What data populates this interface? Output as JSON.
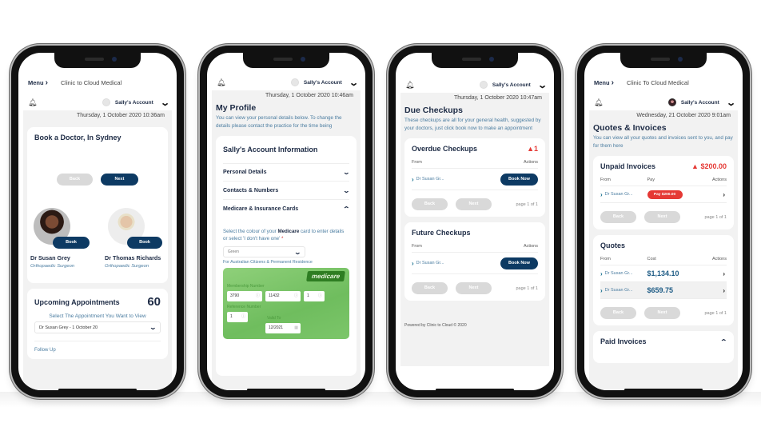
{
  "common": {
    "menu_label": "Menu",
    "account_name": "Sally's Account"
  },
  "phone1": {
    "clinic_name": "Clinic to Cloud Medical",
    "datetime": "Thursday, 1 October 2020 10:36am",
    "book_title": "Book a Doctor, In Sydney",
    "back_label": "Back",
    "next_label": "Next",
    "doctors": [
      {
        "name": "Dr Susan Grey",
        "specialty": "Orthopaedic Surgeon",
        "book_label": "Book"
      },
      {
        "name": "Dr Thomas Richards",
        "specialty": "Orthopaedic Surgeon",
        "book_label": "Book"
      }
    ],
    "appointments_title": "Upcoming Appointments",
    "appointments_count": "60",
    "appointments_subtitle": "Select The Appointment You Want to View",
    "appointment_selected": "Dr Susan Grey - 1 October 20",
    "follow_up": "Follow Up"
  },
  "phone2": {
    "datetime": "Thursday, 1 October 2020 10:46am",
    "page_title": "My Profile",
    "page_desc": "You can view your personal details below. To change the details please contact the practice for the time being",
    "card_title": "Sally's Account Information",
    "sections": [
      {
        "label": "Personal Details",
        "expanded": false
      },
      {
        "label": "Contacts & Numbers",
        "expanded": false
      },
      {
        "label": "Medicare & Insurance Cards",
        "expanded": true
      }
    ],
    "medicare_prompt_pre": "Select the colour of your ",
    "medicare_prompt_bold": "Medicare",
    "medicare_prompt_post": " card to enter details or select 'I don't have one'",
    "required_mark": "*",
    "card_colour": "Green",
    "residence_note": "For Australian Citizens & Permanent Residence",
    "medicare_card": {
      "logo": "medicare",
      "membership_label": "Membership Number",
      "membership_parts": [
        "3790",
        "11432",
        "1"
      ],
      "reference_label": "Reference Number",
      "reference": "1",
      "valid_label": "Valid To",
      "valid_to": "12/2021"
    }
  },
  "phone3": {
    "datetime": "Thursday, 1 October 2020 10:47am",
    "page_title": "Due Checkups",
    "page_desc": "These checkups are all for your general health, suggested by your doctors, just click book now to make an appointment",
    "overdue": {
      "title": "Overdue Checkups",
      "alert_count": "1",
      "col_from": "From",
      "col_actions": "Actions",
      "rows": [
        {
          "from": "Dr Susan Gr...",
          "action": "Book Now"
        }
      ],
      "back_label": "Back",
      "next_label": "Next",
      "page_info": "page 1 of 1"
    },
    "future": {
      "title": "Future Checkups",
      "col_from": "From",
      "col_actions": "Actions",
      "rows": [
        {
          "from": "Dr Susan Gr...",
          "action": "Book Now"
        }
      ],
      "back_label": "Back",
      "next_label": "Next",
      "page_info": "page 1 of 1"
    },
    "powered_by": "Powered by Clinic to Cloud © 2020"
  },
  "phone4": {
    "clinic_name": "Clinic To Cloud Medical",
    "datetime": "Wednesday, 21 October 2020 9:01am",
    "page_title": "Quotes & Invoices",
    "page_desc": "You can view all your quotes and invoices sent to you, and pay for them here",
    "unpaid": {
      "title": "Unpaid Invoices",
      "total": "$200.00",
      "col_from": "From",
      "col_pay": "Pay",
      "col_actions": "Actions",
      "rows": [
        {
          "from": "Dr Susan Gr...",
          "pay_label": "Pay $200.00"
        }
      ],
      "back_label": "Back",
      "next_label": "Next",
      "page_info": "page 1 of 1"
    },
    "quotes": {
      "title": "Quotes",
      "col_from": "From",
      "col_cost": "Cost",
      "col_actions": "Actions",
      "rows": [
        {
          "from": "Dr Susan Gr...",
          "cost": "$1,134.10"
        },
        {
          "from": "Dr Susan Gr...",
          "cost": "$659.75"
        }
      ],
      "back_label": "Back",
      "next_label": "Next",
      "page_info": "page 1 of 1"
    },
    "paid": {
      "title": "Paid Invoices"
    }
  }
}
